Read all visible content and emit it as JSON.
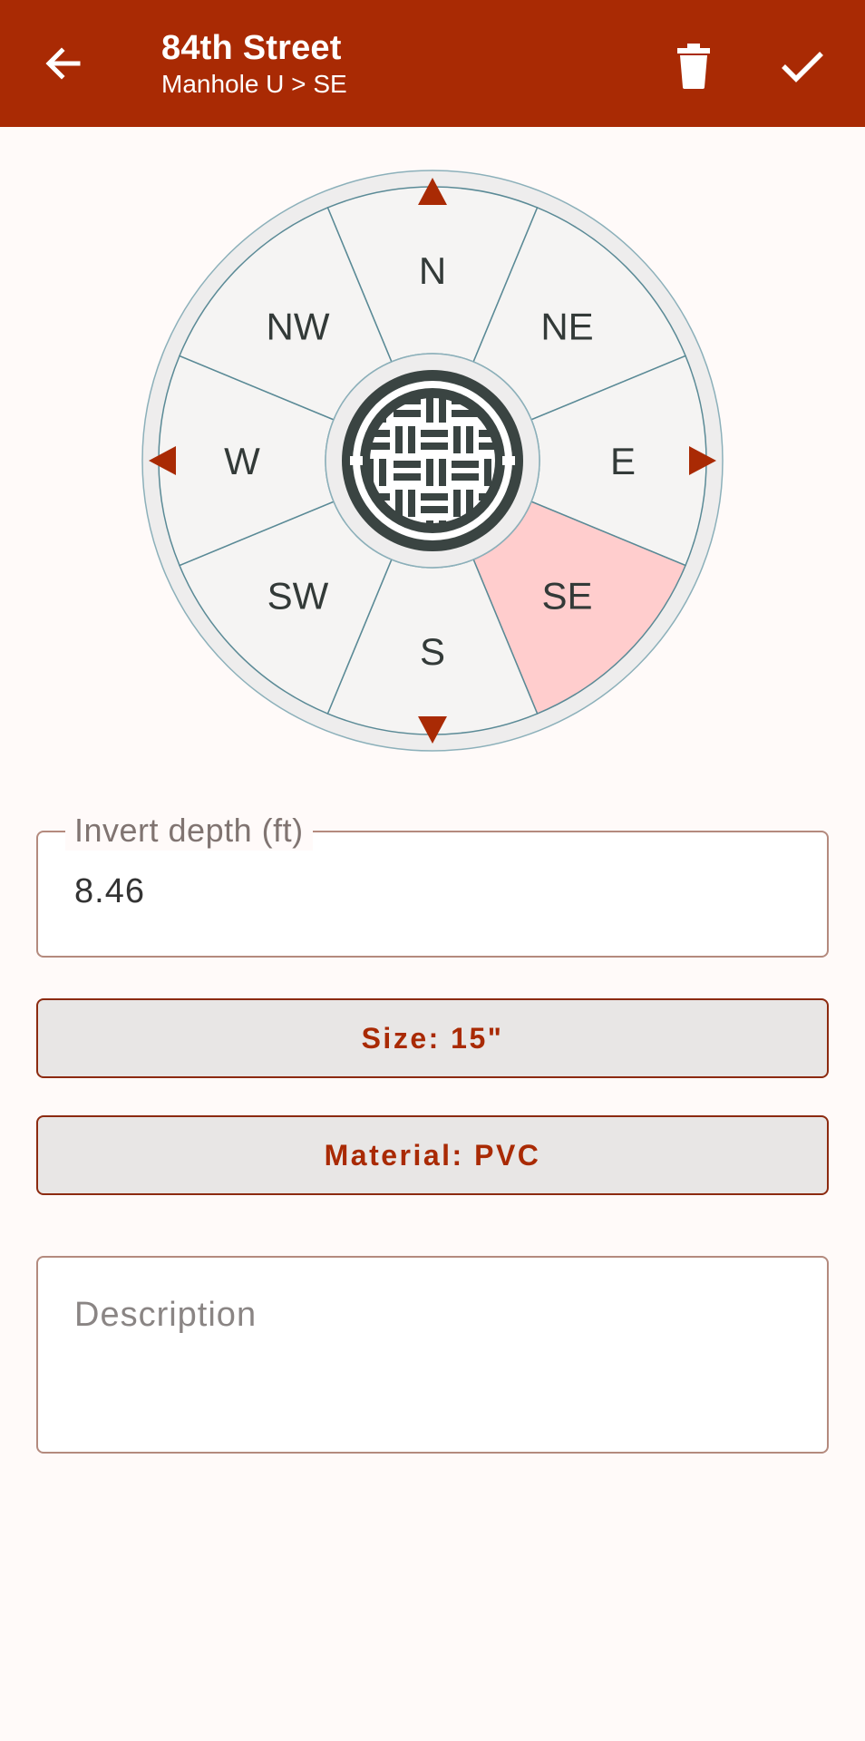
{
  "header": {
    "title": "84th Street",
    "subtitle": "Manhole U > SE",
    "back_icon": "arrow-left-icon",
    "delete_icon": "trash-icon",
    "confirm_icon": "check-icon"
  },
  "compass": {
    "directions": [
      "N",
      "NE",
      "E",
      "SE",
      "S",
      "SW",
      "W",
      "NW"
    ],
    "selected": "SE",
    "center_icon": "manhole-cover-icon"
  },
  "invert_depth": {
    "label": "Invert depth (ft)",
    "value": "8.46"
  },
  "size_button": {
    "label": "Size: 15\""
  },
  "material_button": {
    "label": "Material: PVC"
  },
  "description": {
    "placeholder": "Description"
  },
  "colors": {
    "primary": "#A92A04",
    "selected_sector": "#FFCDCD",
    "sector": "#F5F4F3",
    "divider": "#5A8A96"
  }
}
